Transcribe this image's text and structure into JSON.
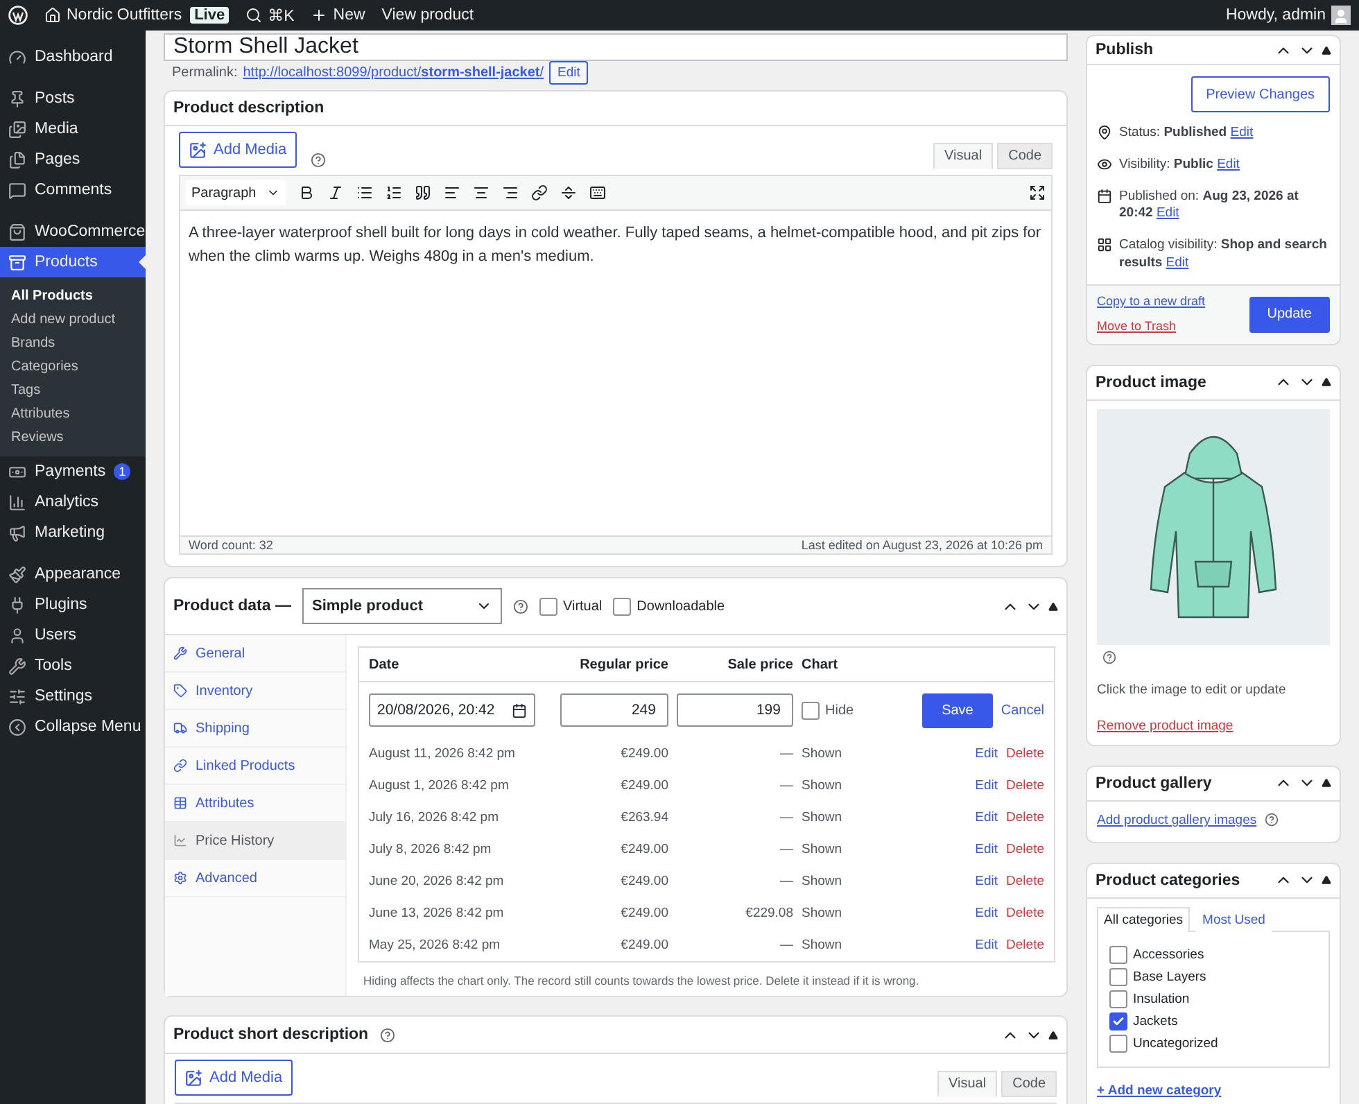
{
  "admin_bar": {
    "site_name": "Nordic Outfitters",
    "live_badge": "Live",
    "shortcut": "⌘K",
    "new_label": "New",
    "view_label": "View product",
    "greeting": "Howdy, admin"
  },
  "sidebar": {
    "groups": [
      [
        {
          "label": "Dashboard",
          "selected": false
        }
      ],
      [
        {
          "label": "Posts",
          "selected": false
        },
        {
          "label": "Media",
          "selected": false
        },
        {
          "label": "Pages",
          "selected": false
        },
        {
          "label": "Comments",
          "selected": false
        }
      ],
      [
        {
          "label": "WooCommerce",
          "selected": false
        },
        {
          "label": "Products",
          "selected": true,
          "children": [
            {
              "label": "All Products",
              "selected": true
            },
            {
              "label": "Add new product",
              "selected": false
            },
            {
              "label": "Brands",
              "selected": false
            },
            {
              "label": "Categories",
              "selected": false
            },
            {
              "label": "Tags",
              "selected": false
            },
            {
              "label": "Attributes",
              "selected": false
            },
            {
              "label": "Reviews",
              "selected": false
            }
          ]
        },
        {
          "label": "Payments",
          "selected": false,
          "badge": "1"
        },
        {
          "label": "Analytics",
          "selected": false
        },
        {
          "label": "Marketing",
          "selected": false
        }
      ],
      [
        {
          "label": "Appearance",
          "selected": false
        },
        {
          "label": "Plugins",
          "selected": false
        },
        {
          "label": "Users",
          "selected": false
        },
        {
          "label": "Tools",
          "selected": false
        },
        {
          "label": "Settings",
          "selected": false
        },
        {
          "label": "Collapse Menu",
          "selected": false
        }
      ]
    ]
  },
  "title": "Storm Shell Jacket",
  "permalink": {
    "label": "Permalink:",
    "url": "http://localhost:8099/product/**storm-shell-jacket**/",
    "edit": "Edit"
  },
  "description": {
    "title": "Product description",
    "add_media": "Add Media",
    "editor_tabs": [
      {
        "label": "Visual",
        "selected": true
      },
      {
        "label": "Code",
        "selected": false
      }
    ],
    "format": "Paragraph",
    "body": "A three-layer waterproof shell built for long days in cold weather. Fully taped seams, a helmet-compatible hood, and pit zips for when the climb warms up. Weighs 480g in a men's medium.",
    "word_count": "Word count: 32",
    "last_edited": "Last edited on August 23, 2026 at 10:26 pm"
  },
  "product_data": {
    "title": "Product data —",
    "type": "Simple product",
    "options": [
      {
        "label": "Virtual",
        "checked": false
      },
      {
        "label": "Downloadable",
        "checked": false
      }
    ],
    "tabs": [
      {
        "label": "General",
        "selected": false
      },
      {
        "label": "Inventory",
        "selected": false
      },
      {
        "label": "Shipping",
        "selected": false
      },
      {
        "label": "Linked Products",
        "selected": false
      },
      {
        "label": "Attributes",
        "selected": false
      },
      {
        "label": "Price History",
        "selected": true
      },
      {
        "label": "Advanced",
        "selected": false
      }
    ],
    "history": {
      "columns": [
        "Date",
        "Regular price",
        "Sale price",
        "Chart"
      ],
      "edit_row": {
        "date": "20/08/2026, 20:42",
        "regular": "249",
        "sale": "199",
        "hide": {
          "label": "Hide",
          "checked": false
        },
        "save": "Save",
        "cancel": "Cancel"
      },
      "rows": [
        {
          "date": "August 11, 2026 8:42 pm",
          "regular": "€249.00",
          "sale": "—",
          "chart": "Shown",
          "edit": "Edit",
          "delete": "Delete"
        },
        {
          "date": "August 1, 2026 8:42 pm",
          "regular": "€249.00",
          "sale": "—",
          "chart": "Shown",
          "edit": "Edit",
          "delete": "Delete"
        },
        {
          "date": "July 16, 2026 8:42 pm",
          "regular": "€263.94",
          "sale": "—",
          "chart": "Shown",
          "edit": "Edit",
          "delete": "Delete"
        },
        {
          "date": "July 8, 2026 8:42 pm",
          "regular": "€249.00",
          "sale": "—",
          "chart": "Shown",
          "edit": "Edit",
          "delete": "Delete"
        },
        {
          "date": "June 20, 2026 8:42 pm",
          "regular": "€249.00",
          "sale": "—",
          "chart": "Shown",
          "edit": "Edit",
          "delete": "Delete"
        },
        {
          "date": "June 13, 2026 8:42 pm",
          "regular": "€249.00",
          "sale": "€229.08",
          "chart": "Shown",
          "edit": "Edit",
          "delete": "Delete"
        },
        {
          "date": "May 25, 2026 8:42 pm",
          "regular": "€249.00",
          "sale": "—",
          "chart": "Shown",
          "edit": "Edit",
          "delete": "Delete"
        }
      ],
      "note": "Hiding affects the chart only. The record still counts towards the lowest price. Delete it instead if it is wrong."
    }
  },
  "short_description": {
    "title": "Product short description",
    "add_media": "Add Media",
    "editor_tabs": [
      {
        "label": "Visual",
        "selected": true
      },
      {
        "label": "Code",
        "selected": false
      }
    ]
  },
  "publish": {
    "title": "Publish",
    "preview": "Preview Changes",
    "fields": [
      {
        "label": "Status:",
        "value": "Published",
        "edit": "Edit"
      },
      {
        "label": "Visibility:",
        "value": "Public",
        "edit": "Edit"
      },
      {
        "label": "Published on:",
        "value": "Aug 23, 2026 at 20:42",
        "edit": "Edit"
      },
      {
        "label": "Catalog visibility:",
        "value": "Shop and search results",
        "edit": "Edit"
      }
    ],
    "copy": "Copy to a new draft",
    "trash": "Move to Trash",
    "update": "Update"
  },
  "product_image": {
    "title": "Product image",
    "hint": "Click the image to edit or update",
    "remove": "Remove product image"
  },
  "gallery": {
    "title": "Product gallery",
    "add": "Add product gallery images"
  },
  "categories": {
    "title": "Product categories",
    "tabs": [
      {
        "label": "All categories",
        "selected": true
      },
      {
        "label": "Most Used",
        "selected": false
      }
    ],
    "items": [
      {
        "label": "Accessories",
        "checked": false
      },
      {
        "label": "Base Layers",
        "checked": false
      },
      {
        "label": "Insulation",
        "checked": false
      },
      {
        "label": "Jackets",
        "checked": true
      },
      {
        "label": "Uncategorized",
        "checked": false
      }
    ],
    "add": "+ Add new category"
  }
}
